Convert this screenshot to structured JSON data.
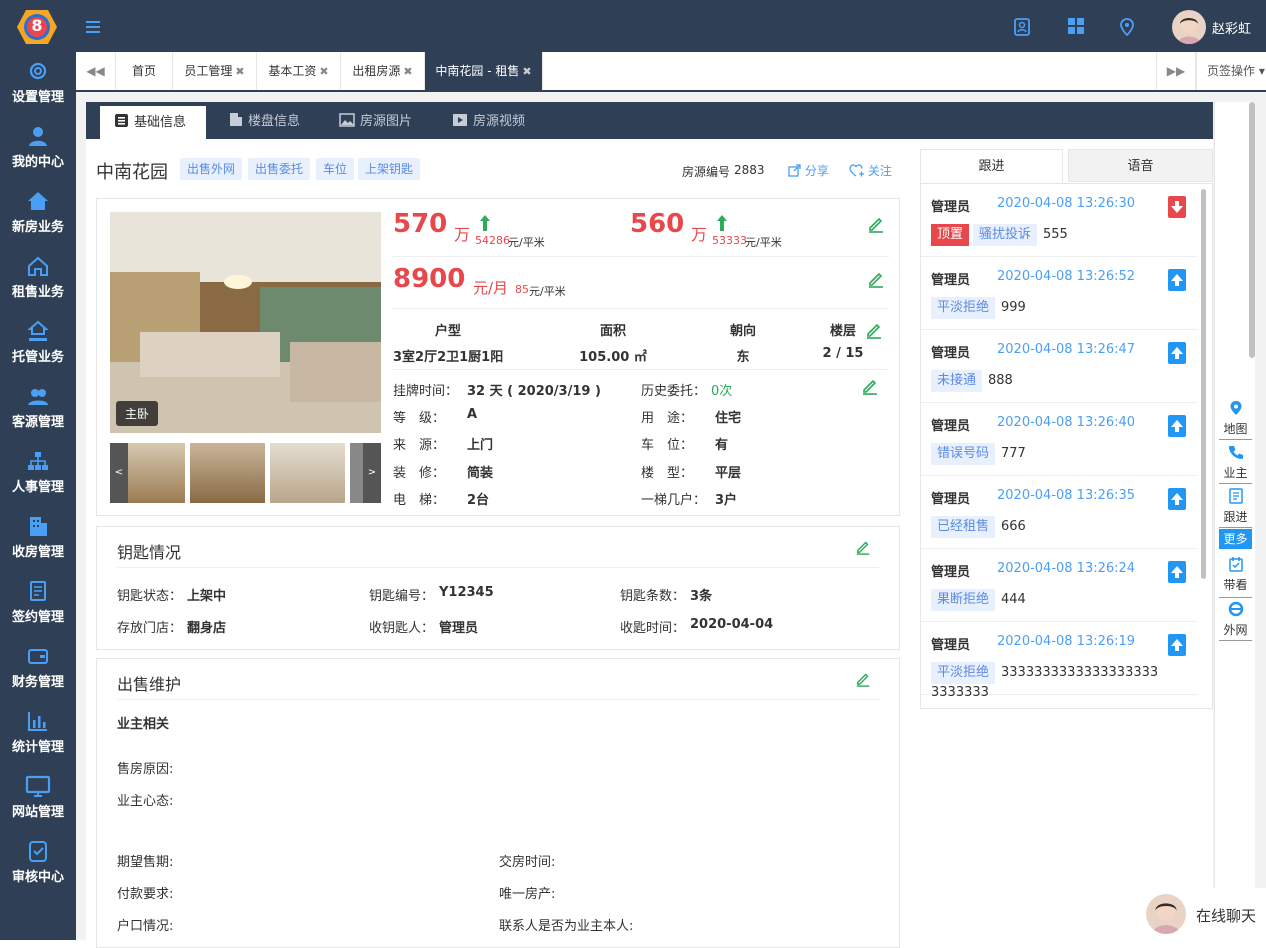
{
  "sidebar": {
    "logo_text": "8",
    "items": [
      {
        "label": "设置管理",
        "icon": "gear-icon"
      },
      {
        "label": "我的中心",
        "icon": "user-icon"
      },
      {
        "label": "新房业务",
        "icon": "house-icon"
      },
      {
        "label": "租售业务",
        "icon": "home-outline-icon"
      },
      {
        "label": "托管业务",
        "icon": "hand-house-icon"
      },
      {
        "label": "客源管理",
        "icon": "users-icon"
      },
      {
        "label": "人事管理",
        "icon": "org-chart-icon"
      },
      {
        "label": "收房管理",
        "icon": "building-icon"
      },
      {
        "label": "签约管理",
        "icon": "contract-icon"
      },
      {
        "label": "财务管理",
        "icon": "wallet-icon"
      },
      {
        "label": "统计管理",
        "icon": "bar-chart-icon"
      },
      {
        "label": "网站管理",
        "icon": "monitor-icon"
      },
      {
        "label": "审核中心",
        "icon": "check-doc-icon"
      }
    ]
  },
  "topbar": {
    "user_name": "赵彩虹"
  },
  "tabs": [
    {
      "label": "首页",
      "closable": false
    },
    {
      "label": "员工管理",
      "closable": true
    },
    {
      "label": "基本工资",
      "closable": true
    },
    {
      "label": "出租房源",
      "closable": true
    },
    {
      "label": "中南花园 - 租售",
      "closable": true,
      "active": true
    }
  ],
  "tab_ops_label": "页签操作",
  "subtabs": [
    "基础信息",
    "楼盘信息",
    "房源图片",
    "房源视频"
  ],
  "property": {
    "name": "中南花园",
    "tags": [
      "出售外网",
      "出售委托",
      "车位",
      "上架钥匙"
    ],
    "code_label": "房源编号",
    "code": "2883",
    "share_label": "分享",
    "follow_label": "关注",
    "photo_caption": "主卧",
    "price1": "570",
    "price1_unit": "万",
    "price1_unit_price": "54286",
    "price2": "560",
    "price2_unit": "万",
    "price2_unit_price": "53333",
    "unit_suffix": "元/平米",
    "rent": "8900",
    "rent_unit": "元/月",
    "rent_unit_price": "85",
    "spec_headers": [
      "户型",
      "面积",
      "朝向",
      "楼层"
    ],
    "spec_values": [
      "3室2厅2卫1厨1阳",
      "105.00 ㎡",
      "东",
      "2 / 15"
    ],
    "listing_label": "挂牌时间：",
    "listing_value": "32 天 ( 2020/3/19 )",
    "history_label": "历史委托：",
    "history_value": "0次",
    "details_left": [
      {
        "label": "等　级：",
        "value": "A"
      },
      {
        "label": "来　源：",
        "value": "上门"
      },
      {
        "label": "装　修：",
        "value": "简装"
      },
      {
        "label": "电　梯：",
        "value": "2台"
      }
    ],
    "details_right": [
      {
        "label": "用　途：",
        "value": "住宅"
      },
      {
        "label": "车　位：",
        "value": "有"
      },
      {
        "label": "楼　型：",
        "value": "平层"
      },
      {
        "label": "一梯几户：",
        "value": "3户"
      }
    ]
  },
  "keys": {
    "title": "钥匙情况",
    "rows": [
      [
        {
          "label": "钥匙状态：",
          "value": "上架中"
        },
        {
          "label": "钥匙编号：",
          "value": "Y12345"
        },
        {
          "label": "钥匙条数：",
          "value": "3条"
        }
      ],
      [
        {
          "label": "存放门店：",
          "value": "翻身店"
        },
        {
          "label": "收钥匙人：",
          "value": "管理员"
        },
        {
          "label": "收匙时间：",
          "value": "2020-04-04"
        }
      ]
    ]
  },
  "sale": {
    "title": "出售维护",
    "owner_section": "业主相关",
    "fields_a": [
      "售房原因:",
      "业主心态:"
    ],
    "fields_left": [
      "期望售期:",
      "付款要求:",
      "户口情况:"
    ],
    "fields_right": [
      "交房时间:",
      "唯一房产:",
      "联系人是否为业主本人:"
    ]
  },
  "follow": {
    "tab_follow": "跟进",
    "tab_voice": "语音",
    "items": [
      {
        "who": "管理员",
        "time": "2020-04-08 13:26:30",
        "tags": [
          "顶置",
          "骚扰投诉"
        ],
        "value": "555",
        "down": true
      },
      {
        "who": "管理员",
        "time": "2020-04-08 13:26:52",
        "tags": [
          "平淡拒绝"
        ],
        "value": "999"
      },
      {
        "who": "管理员",
        "time": "2020-04-08 13:26:47",
        "tags": [
          "未接通"
        ],
        "value": "888"
      },
      {
        "who": "管理员",
        "time": "2020-04-08 13:26:40",
        "tags": [
          "错误号码"
        ],
        "value": "777"
      },
      {
        "who": "管理员",
        "time": "2020-04-08 13:26:35",
        "tags": [
          "已经租售"
        ],
        "value": "666"
      },
      {
        "who": "管理员",
        "time": "2020-04-08 13:26:24",
        "tags": [
          "果断拒绝"
        ],
        "value": "444"
      },
      {
        "who": "管理员",
        "time": "2020-04-08 13:26:19",
        "tags": [
          "平淡拒绝"
        ],
        "value": "3333333333333333333",
        "value2": "3333333"
      }
    ]
  },
  "quick": [
    "地图",
    "业主",
    "跟进",
    "更多",
    "带看",
    "外网"
  ],
  "chat_label": "在线聊天"
}
